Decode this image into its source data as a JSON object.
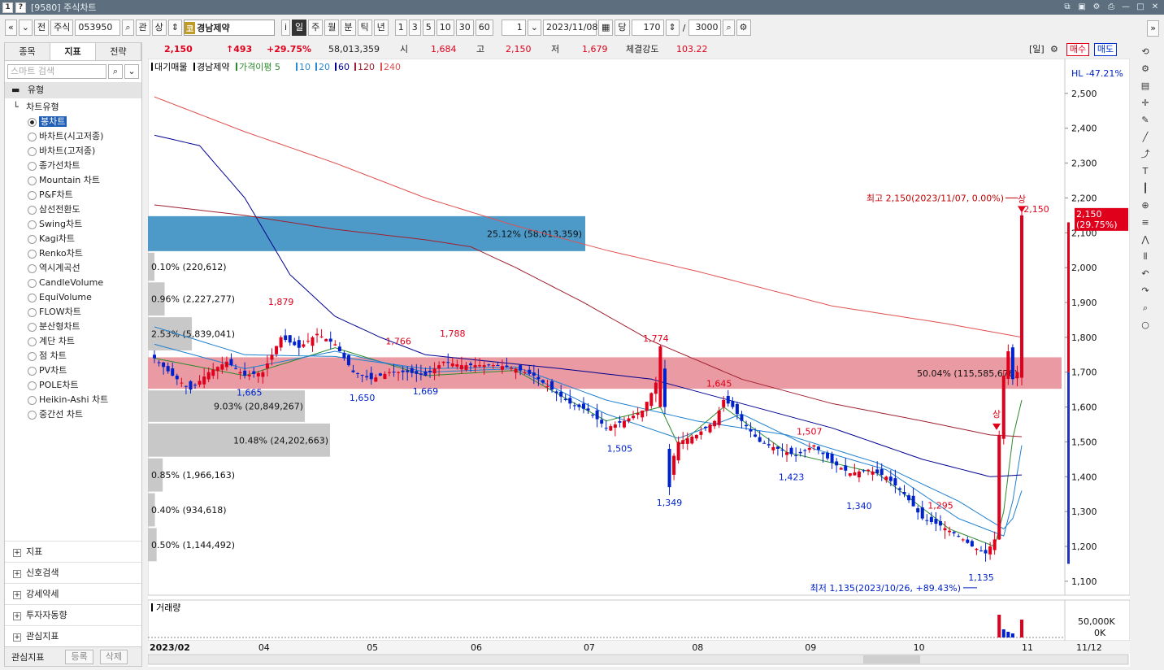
{
  "window": {
    "title": "[9580] 주식차트",
    "badge_left": "1",
    "badge_help": "?"
  },
  "toolbar": {
    "b_jeon": "전",
    "market": "주식",
    "code": "053950",
    "b_gwan": "관",
    "b_sang": "상",
    "stock_kind": "코",
    "stock_name": "경남제약",
    "b_i": "i",
    "periods": [
      "일",
      "주",
      "월",
      "분",
      "틱",
      "년"
    ],
    "intervals": [
      "1",
      "3",
      "5",
      "10",
      "30",
      "60"
    ],
    "unit": "1",
    "date": "2023/11/08",
    "b_dang": "당",
    "count": "170",
    "count_sep": "/",
    "total": "3000"
  },
  "left_panel": {
    "tabs": [
      "종목",
      "지표",
      "전략"
    ],
    "search_placeholder": "스마트 검색",
    "section": "유형",
    "tree_head": "차트유형",
    "chart_types": [
      "봉차트",
      "바차트(시고저종)",
      "바차트(고저종)",
      "종가선차트",
      "Mountain 차트",
      "P&F차트",
      "삼선전환도",
      "Swing차트",
      "Kagi차트",
      "Renko차트",
      "역시계곡선",
      "CandleVolume",
      "EquiVolume",
      "FLOW차트",
      "분산형차트",
      "계단 차트",
      "점 차트",
      "PV차트",
      "POLE차트",
      "Heikin-Ashi 차트",
      "중간선 차트"
    ],
    "groups": [
      "지표",
      "신호검색",
      "강세약세",
      "투자자동향",
      "관심지표"
    ],
    "footer_label": "관심지표",
    "footer_btn1": "등록",
    "footer_btn2": "삭제"
  },
  "info_bar": {
    "price": "2,150",
    "change": "↑493",
    "change_pct": "+29.75%",
    "volume": "58,013,359",
    "open_label": "시",
    "open": "1,684",
    "high_label": "고",
    "high": "2,150",
    "low_label": "저",
    "low": "1,679",
    "strength_label": "체결강도",
    "strength": "103.22",
    "period_tag": "[일]",
    "buy": "매수",
    "sell": "매도"
  },
  "chart_data": {
    "type": "candlestick",
    "legend": {
      "items": [
        "대기매물",
        "경남제약",
        "가격이평 5",
        "10",
        "20",
        "60",
        "120",
        "240"
      ],
      "colors": [
        "#000000",
        "#000000",
        "#2d8a2d",
        "#2a8ad4",
        "#2a8ad4",
        "#000090",
        "#a02030",
        "#e05050"
      ]
    },
    "hl_label": "HL -47.21%",
    "y_ticks": [
      2500,
      2400,
      2300,
      2200,
      2100,
      2000,
      1900,
      1800,
      1700,
      1600,
      1500,
      1400,
      1300,
      1200,
      1100
    ],
    "y_range": [
      1060,
      2600
    ],
    "x_labels": [
      "2023/02",
      "04",
      "05",
      "06",
      "07",
      "08",
      "09",
      "10",
      "11"
    ],
    "x_label_right": "11/12",
    "current_price_tag": "2,150",
    "current_pct_tag": "(29.75%)",
    "volume_profile": [
      {
        "label": "25.12% (58,013,359)",
        "low": 2045,
        "high": 2150,
        "pct": 25.12,
        "highlight": "blue"
      },
      {
        "label": "0.10% (220,612)",
        "low": 1960,
        "high": 2045,
        "pct": 0.1
      },
      {
        "label": "0.96% (2,227,277)",
        "low": 1860,
        "high": 1960,
        "pct": 0.96
      },
      {
        "label": "2.53% (5,839,041)",
        "low": 1760,
        "high": 1860,
        "pct": 2.53
      },
      {
        "label": "50.04% (115,585,676)",
        "low": 1650,
        "high": 1745,
        "pct": 50.04,
        "highlight": "pink"
      },
      {
        "label": "9.03% (20,849,267)",
        "low": 1555,
        "high": 1650,
        "pct": 9.03
      },
      {
        "label": "10.48% (24,202,663)",
        "low": 1455,
        "high": 1555,
        "pct": 10.48
      },
      {
        "label": "0.85% (1,966,163)",
        "low": 1355,
        "high": 1455,
        "pct": 0.85
      },
      {
        "label": "0.40% (934,618)",
        "low": 1255,
        "high": 1355,
        "pct": 0.4
      },
      {
        "label": "0.50% (1,144,492)",
        "low": 1155,
        "high": 1255,
        "pct": 0.5
      }
    ],
    "price_labels": [
      {
        "t": "1,879",
        "v": 1879,
        "i": 28,
        "c": "red",
        "up": true
      },
      {
        "t": "1,665",
        "v": 1665,
        "i": 21,
        "c": "blue",
        "up": false
      },
      {
        "t": "1,650",
        "v": 1650,
        "i": 46,
        "c": "blue",
        "up": false
      },
      {
        "t": "1,766",
        "v": 1766,
        "i": 54,
        "c": "red",
        "up": true
      },
      {
        "t": "1,669",
        "v": 1669,
        "i": 60,
        "c": "blue",
        "up": false
      },
      {
        "t": "1,788",
        "v": 1788,
        "i": 66,
        "c": "red",
        "up": true
      },
      {
        "t": "1,505",
        "v": 1505,
        "i": 103,
        "c": "blue",
        "up": false
      },
      {
        "t": "1,774",
        "v": 1774,
        "i": 111,
        "c": "red",
        "up": true
      },
      {
        "t": "1,349",
        "v": 1349,
        "i": 114,
        "c": "blue",
        "up": false
      },
      {
        "t": "1,645",
        "v": 1645,
        "i": 125,
        "c": "red",
        "up": true
      },
      {
        "t": "1,423",
        "v": 1423,
        "i": 141,
        "c": "blue",
        "up": false
      },
      {
        "t": "1,507",
        "v": 1507,
        "i": 145,
        "c": "red",
        "up": true
      },
      {
        "t": "1,340",
        "v": 1340,
        "i": 156,
        "c": "blue",
        "up": false
      },
      {
        "t": "1,295",
        "v": 1295,
        "i": 174,
        "c": "red",
        "up": true
      },
      {
        "t": "1,135",
        "v": 1135,
        "i": 183,
        "c": "blue",
        "up": false
      }
    ],
    "annotations": {
      "high_note": "최고 2,150(2023/11/07, 0.00%)",
      "low_note": "최저 1,135(2023/10/26, +89.43%)",
      "sang1": "상",
      "sang2": "상",
      "sang_price": "2,150"
    },
    "volume_panel": {
      "title": "거래량",
      "ticks": [
        "50,000K",
        "0K"
      ]
    },
    "anchors": [
      [
        0,
        1740
      ],
      [
        4,
        1690
      ],
      [
        8,
        1650
      ],
      [
        12,
        1700
      ],
      [
        16,
        1730
      ],
      [
        20,
        1690
      ],
      [
        24,
        1700
      ],
      [
        28,
        1800
      ],
      [
        32,
        1770
      ],
      [
        36,
        1810
      ],
      [
        40,
        1780
      ],
      [
        44,
        1700
      ],
      [
        48,
        1680
      ],
      [
        52,
        1700
      ],
      [
        56,
        1700
      ],
      [
        60,
        1690
      ],
      [
        64,
        1730
      ],
      [
        68,
        1720
      ],
      [
        72,
        1720
      ],
      [
        76,
        1720
      ],
      [
        80,
        1710
      ],
      [
        84,
        1690
      ],
      [
        88,
        1650
      ],
      [
        92,
        1610
      ],
      [
        96,
        1590
      ],
      [
        100,
        1540
      ],
      [
        104,
        1560
      ],
      [
        108,
        1590
      ],
      [
        110,
        1640
      ],
      [
        112,
        1700
      ],
      [
        113,
        1600
      ],
      [
        114,
        1420
      ],
      [
        116,
        1500
      ],
      [
        120,
        1520
      ],
      [
        124,
        1560
      ],
      [
        126,
        1620
      ],
      [
        128,
        1600
      ],
      [
        130,
        1560
      ],
      [
        134,
        1500
      ],
      [
        138,
        1480
      ],
      [
        142,
        1460
      ],
      [
        146,
        1490
      ],
      [
        150,
        1440
      ],
      [
        154,
        1410
      ],
      [
        158,
        1420
      ],
      [
        162,
        1400
      ],
      [
        166,
        1350
      ],
      [
        170,
        1280
      ],
      [
        174,
        1260
      ],
      [
        178,
        1230
      ],
      [
        181,
        1200
      ],
      [
        184,
        1180
      ],
      [
        186,
        1220
      ],
      [
        187,
        1520
      ],
      [
        188,
        1690
      ],
      [
        189,
        1760
      ],
      [
        190,
        1680
      ],
      [
        191,
        1700
      ],
      [
        192,
        2150
      ]
    ],
    "ma": [
      {
        "name": "5",
        "color": "#2d8a2d",
        "pts": [
          [
            0,
            1740
          ],
          [
            20,
            1690
          ],
          [
            40,
            1770
          ],
          [
            60,
            1690
          ],
          [
            80,
            1705
          ],
          [
            100,
            1560
          ],
          [
            112,
            1600
          ],
          [
            116,
            1490
          ],
          [
            126,
            1600
          ],
          [
            140,
            1470
          ],
          [
            160,
            1410
          ],
          [
            176,
            1250
          ],
          [
            186,
            1200
          ],
          [
            188,
            1300
          ],
          [
            190,
            1510
          ],
          [
            192,
            1620
          ]
        ]
      },
      {
        "name": "10",
        "color": "#1f80d0",
        "pts": [
          [
            0,
            1780
          ],
          [
            20,
            1710
          ],
          [
            40,
            1760
          ],
          [
            60,
            1700
          ],
          [
            80,
            1710
          ],
          [
            100,
            1580
          ],
          [
            116,
            1510
          ],
          [
            130,
            1580
          ],
          [
            146,
            1480
          ],
          [
            162,
            1420
          ],
          [
            178,
            1280
          ],
          [
            188,
            1230
          ],
          [
            190,
            1330
          ],
          [
            192,
            1490
          ]
        ]
      },
      {
        "name": "20",
        "color": "#1f80d0",
        "pts": [
          [
            0,
            1830
          ],
          [
            20,
            1750
          ],
          [
            40,
            1745
          ],
          [
            60,
            1710
          ],
          [
            80,
            1715
          ],
          [
            100,
            1620
          ],
          [
            120,
            1560
          ],
          [
            140,
            1520
          ],
          [
            160,
            1440
          ],
          [
            178,
            1330
          ],
          [
            188,
            1250
          ],
          [
            190,
            1280
          ],
          [
            192,
            1360
          ]
        ]
      },
      {
        "name": "60",
        "color": "#000090",
        "pts": [
          [
            0,
            2380
          ],
          [
            10,
            2350
          ],
          [
            20,
            2200
          ],
          [
            30,
            1980
          ],
          [
            40,
            1860
          ],
          [
            50,
            1800
          ],
          [
            60,
            1750
          ],
          [
            75,
            1730
          ],
          [
            90,
            1710
          ],
          [
            110,
            1680
          ],
          [
            130,
            1610
          ],
          [
            150,
            1540
          ],
          [
            170,
            1450
          ],
          [
            185,
            1400
          ],
          [
            192,
            1405
          ]
        ]
      },
      {
        "name": "120",
        "color": "#a02030",
        "pts": [
          [
            0,
            2180
          ],
          [
            20,
            2150
          ],
          [
            40,
            2110
          ],
          [
            60,
            2080
          ],
          [
            70,
            2060
          ],
          [
            80,
            2000
          ],
          [
            95,
            1900
          ],
          [
            110,
            1790
          ],
          [
            130,
            1680
          ],
          [
            150,
            1610
          ],
          [
            170,
            1560
          ],
          [
            185,
            1520
          ],
          [
            192,
            1515
          ]
        ]
      },
      {
        "name": "240",
        "color": "#e05050",
        "pts": [
          [
            0,
            2490
          ],
          [
            20,
            2390
          ],
          [
            40,
            2300
          ],
          [
            60,
            2200
          ],
          [
            80,
            2120
          ],
          [
            100,
            2050
          ],
          [
            120,
            1990
          ],
          [
            150,
            1890
          ],
          [
            175,
            1840
          ],
          [
            192,
            1800
          ]
        ]
      }
    ],
    "current_price": 2150
  }
}
